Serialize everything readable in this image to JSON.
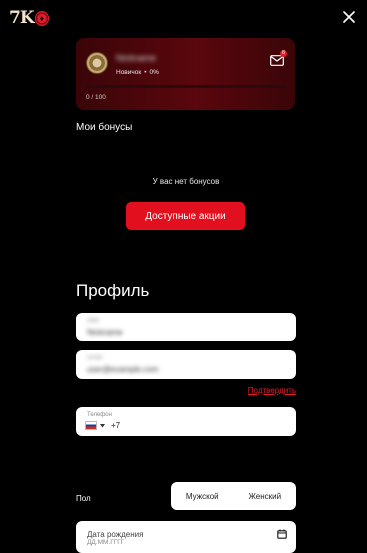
{
  "header": {
    "logo_text": "7K",
    "close_icon": "close-icon"
  },
  "status_card": {
    "username": "Nickname",
    "level": "Новичок",
    "separator": "•",
    "level_percent": "0%",
    "mail_badge": "8",
    "progress_text": "0 / 100",
    "progress_fraction": 0,
    "avatar_icon": "avatar-coin-icon",
    "mail_icon": "mail-icon"
  },
  "bonuses": {
    "title": "Мои бонусы",
    "empty_text": "У вас нет бонусов",
    "button_label": "Доступные акции"
  },
  "profile": {
    "title": "Профиль",
    "name_label": "Имя",
    "name_value": "Nickname",
    "email_label": "Email",
    "email_value": "user@example.com",
    "confirm_link": "Подтвердить",
    "phone_label": "Телефон",
    "phone_code": "+7",
    "gender_label": "Пол",
    "gender_male": "Мужской",
    "gender_female": "Женский",
    "birth_label": "Дата рождения",
    "birth_placeholder": "ДД.ММ.ГГГГ"
  },
  "colors": {
    "accent": "#e2101f",
    "card_bg": "#4a060b",
    "background": "#000000"
  }
}
